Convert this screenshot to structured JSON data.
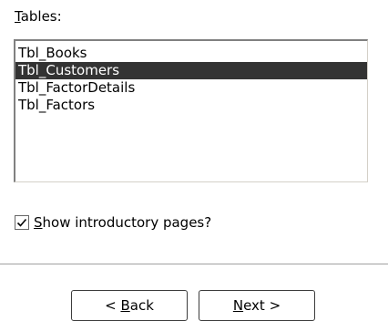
{
  "tables_label": "Tables:",
  "tables": [
    {
      "name": "Tbl_Books",
      "selected": false
    },
    {
      "name": "Tbl_Customers",
      "selected": true
    },
    {
      "name": "Tbl_FactorDetails",
      "selected": false
    },
    {
      "name": "Tbl_Factors",
      "selected": false
    }
  ],
  "intro_checkbox": {
    "label": "Show introductory pages?",
    "checked": true
  },
  "buttons": {
    "back": "< Back",
    "next": "Next >"
  },
  "colors": {
    "selection_bg": "#333333",
    "selection_fg": "#ffffff"
  }
}
